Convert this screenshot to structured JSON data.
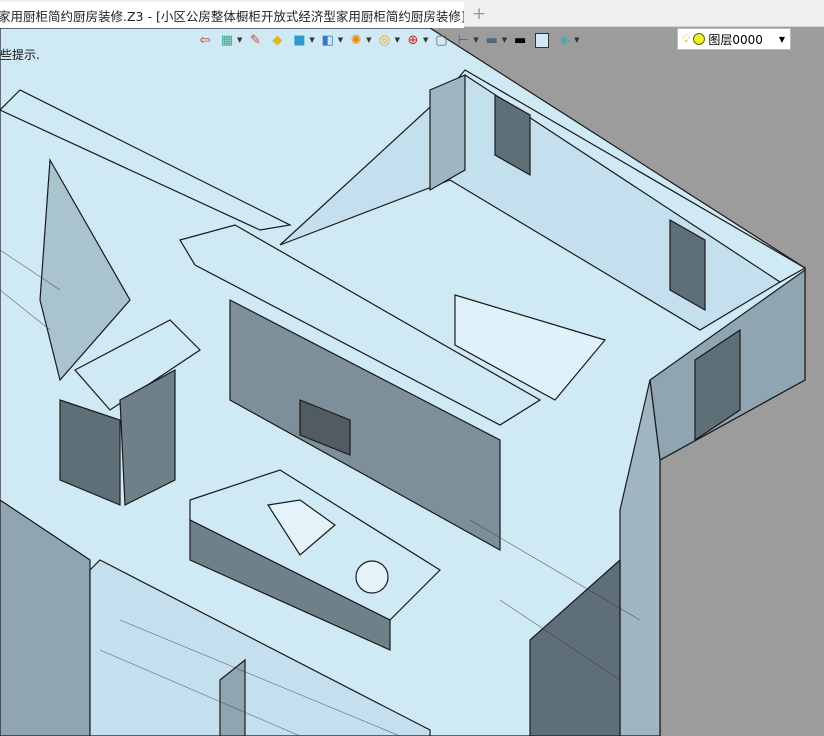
{
  "tab": {
    "title": "家用厨柜简约厨房装修.Z3 - [小区公房整体橱柜开放式经济型家用厨柜简约厨房装修]",
    "close": "✕",
    "new_tab": "+"
  },
  "viewport": {
    "hint": "些提示.",
    "model_color": "#cfe9f5",
    "background": "#9c9c9c"
  },
  "toolbar": {
    "icons": [
      "exit-icon",
      "layers-icon",
      "pencil-icon",
      "shape-icon",
      "cube-icon",
      "view-icon",
      "render-icon",
      "filter-icon",
      "pick-icon",
      "frame-icon",
      "dimension-icon",
      "display-icon",
      "line-color-icon",
      "fill-color-icon",
      "material-icon"
    ]
  },
  "layer": {
    "value": "图层0000"
  }
}
